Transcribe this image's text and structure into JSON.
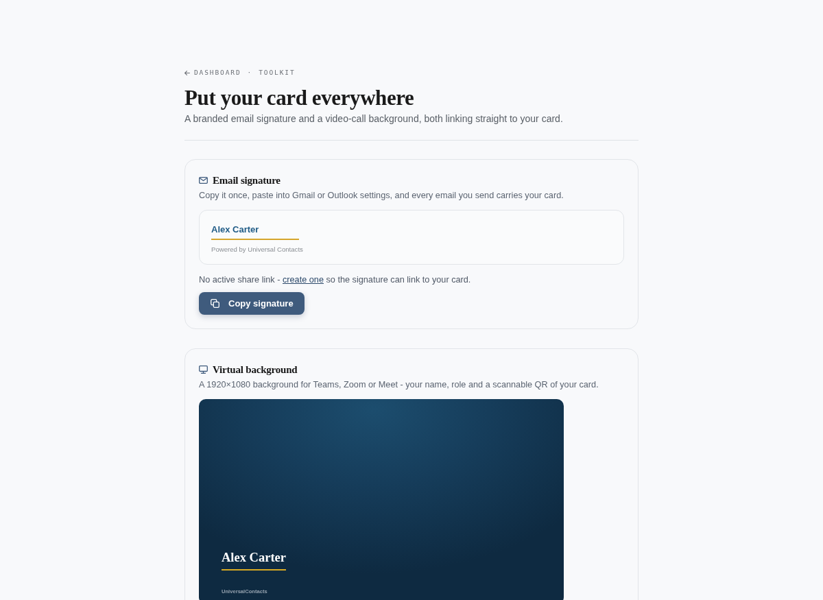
{
  "breadcrumb": {
    "back": "DASHBOARD",
    "separator": "·",
    "current": "TOOLKIT"
  },
  "header": {
    "title": "Put your card everywhere",
    "subtitle": "A branded email signature and a video-call background, both linking straight to your card."
  },
  "sections": [
    {
      "kind": "email_signature",
      "title": "Email signature",
      "description": "Copy it once, paste into Gmail or Outlook settings, and every email you send carries your card.",
      "preview": {
        "name": "Alex Carter",
        "footer": "Powered by Universal Contacts"
      },
      "note": {
        "before": "No active share link - ",
        "link": "create one",
        "after": " so the signature can link to your card."
      },
      "button": "Copy signature"
    },
    {
      "kind": "virtual_background",
      "title": "Virtual background",
      "description": "A 1920×1080 background for Teams, Zoom or Meet - your name, role and a scannable QR of your card.",
      "preview": {
        "name": "Alex Carter",
        "footer": "UniversalContacts"
      }
    }
  ]
}
